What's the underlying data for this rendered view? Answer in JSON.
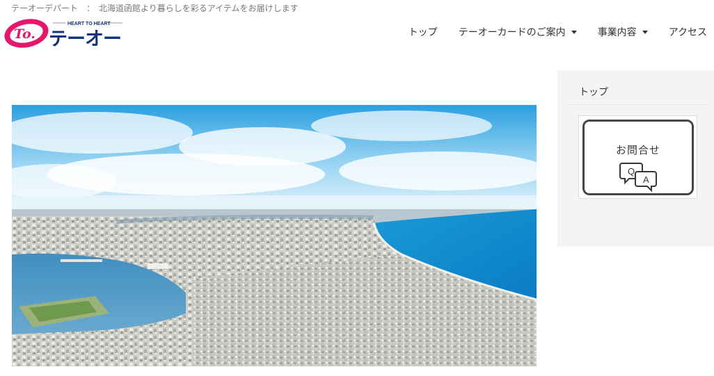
{
  "header": {
    "tagline": "テーオーデパート　：　北海道函館より暮らしを彩るアイテムをお届けします",
    "logo": {
      "alt_text": "Heart to Heart テーオー",
      "mark_text": "To.",
      "small_text": "HEART TO HEART",
      "main_text": "テーオー",
      "colors": {
        "pink": "#e3176e",
        "navy": "#12337a"
      }
    }
  },
  "nav": {
    "items": [
      {
        "label": "トップ",
        "has_dropdown": false
      },
      {
        "label": "テーオーカードのご案内",
        "has_dropdown": true
      },
      {
        "label": "事業内容",
        "has_dropdown": true
      },
      {
        "label": "アクセス",
        "has_dropdown": false
      }
    ]
  },
  "hero": {
    "description": "aerial city harbor panorama"
  },
  "sidebar": {
    "title": "トップ",
    "qa_banner": {
      "label": "お問合せ",
      "bubble_q": "Q",
      "bubble_a": "A"
    }
  }
}
